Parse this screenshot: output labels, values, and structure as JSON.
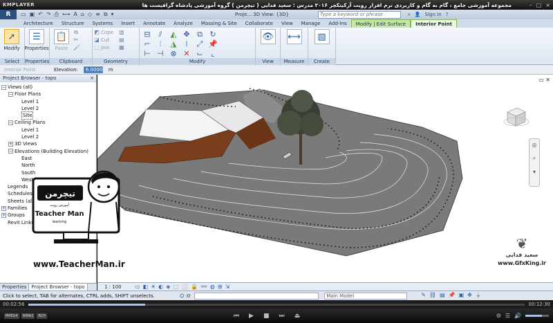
{
  "player": {
    "logo": "KMPLAYER",
    "movie_title": "مجموعه آموزشی جامع ، گام به گام و کاربردی نرم افزار رویت آرکیتکچر ۲۰۱۶  مدرس : سعید فدایی ( تیچرمن ) گروه آموزشی پادشاه گرافیست ها",
    "elapsed": "00:02:56",
    "total": "00:12:30",
    "progress": 0.235,
    "volume": 0.7,
    "chips": [
      "MPEG4",
      "WMA2",
      "RCH"
    ],
    "colors": {
      "progress": "#9fc4ff",
      "titlebar": "#111111"
    }
  },
  "revit": {
    "app_letter": "R",
    "doc_title": "Proje... 3D View: {3D}",
    "search_placeholder": "Type a keyword or phrase",
    "sign_in": "Sign In",
    "tabs": [
      {
        "label": "Architecture",
        "kind": "normal"
      },
      {
        "label": "Structure",
        "kind": "normal"
      },
      {
        "label": "Systems",
        "kind": "normal"
      },
      {
        "label": "Insert",
        "kind": "normal"
      },
      {
        "label": "Annotate",
        "kind": "normal"
      },
      {
        "label": "Analyze",
        "kind": "normal"
      },
      {
        "label": "Massing & Site",
        "kind": "normal"
      },
      {
        "label": "Collaborate",
        "kind": "normal"
      },
      {
        "label": "View",
        "kind": "normal"
      },
      {
        "label": "Manage",
        "kind": "normal"
      },
      {
        "label": "Add-Ins",
        "kind": "normal"
      },
      {
        "label": "Modify | Edit Surface",
        "kind": "context"
      },
      {
        "label": "Interior Point",
        "kind": "active-context"
      }
    ],
    "panels": {
      "select": {
        "label": "Select",
        "tool": "Modify"
      },
      "properties": {
        "label": "Properties",
        "tool": "Properties"
      },
      "clipboard": {
        "label": "Clipboard",
        "tool": "Paste"
      },
      "geometry": {
        "label": "Geometry",
        "tools": [
          "Cope",
          "Cut",
          "Join"
        ]
      },
      "modify": {
        "label": "Modify"
      },
      "view": {
        "label": "View"
      },
      "measure": {
        "label": "Measure"
      },
      "create": {
        "label": "Create"
      }
    },
    "options_bar": {
      "mode": "Interior Point",
      "elevation_label": "Elevation:",
      "elevation_value": "6.0000",
      "unit": "m"
    },
    "browser": {
      "title": "Project Browser - topo",
      "tree": [
        {
          "label": "Views (all)",
          "depth": 0,
          "toggle": "-"
        },
        {
          "label": "Floor Plans",
          "depth": 1,
          "toggle": "-"
        },
        {
          "label": "Level 1",
          "depth": 2,
          "toggle": ""
        },
        {
          "label": "Level 2",
          "depth": 2,
          "toggle": ""
        },
        {
          "label": "Site",
          "depth": 2,
          "toggle": "",
          "selected": true
        },
        {
          "label": "Ceiling Plans",
          "depth": 1,
          "toggle": "-"
        },
        {
          "label": "Level 1",
          "depth": 2,
          "toggle": ""
        },
        {
          "label": "Level 2",
          "depth": 2,
          "toggle": ""
        },
        {
          "label": "3D Views",
          "depth": 1,
          "toggle": "+"
        },
        {
          "label": "Elevations (Building Elevation)",
          "depth": 1,
          "toggle": "-"
        },
        {
          "label": "East",
          "depth": 2,
          "toggle": ""
        },
        {
          "label": "North",
          "depth": 2,
          "toggle": ""
        },
        {
          "label": "South",
          "depth": 2,
          "toggle": ""
        },
        {
          "label": "West",
          "depth": 2,
          "toggle": ""
        },
        {
          "label": "Legends",
          "depth": 0,
          "toggle": ""
        },
        {
          "label": "Schedules/Quantities",
          "depth": 0,
          "toggle": ""
        },
        {
          "label": "Sheets (all)",
          "depth": 0,
          "toggle": ""
        },
        {
          "label": "Families",
          "depth": 0,
          "toggle": "+"
        },
        {
          "label": "Groups",
          "depth": 0,
          "toggle": "+"
        },
        {
          "label": "Revit Links",
          "depth": 0,
          "toggle": ""
        }
      ],
      "tabs": [
        "Properties",
        "Project Browser - topo"
      ]
    },
    "view_bar": {
      "scale": "1 : 100"
    },
    "status": {
      "text": "Click to select, TAB for alternates, CTRL adds, SHIFT unselects.",
      "model": "Main Model",
      "zero": ":0"
    }
  },
  "overlay": {
    "brand_fa": "تیچرمن",
    "brand_sub": "آموزش رویت",
    "brand_en": "Teacher Man",
    "brand_en_sub": "learning",
    "url": "www.TeacherMan.ir",
    "gfx_name": "سعید فدایی",
    "gfx_url": "www.GfxKing.ir"
  }
}
